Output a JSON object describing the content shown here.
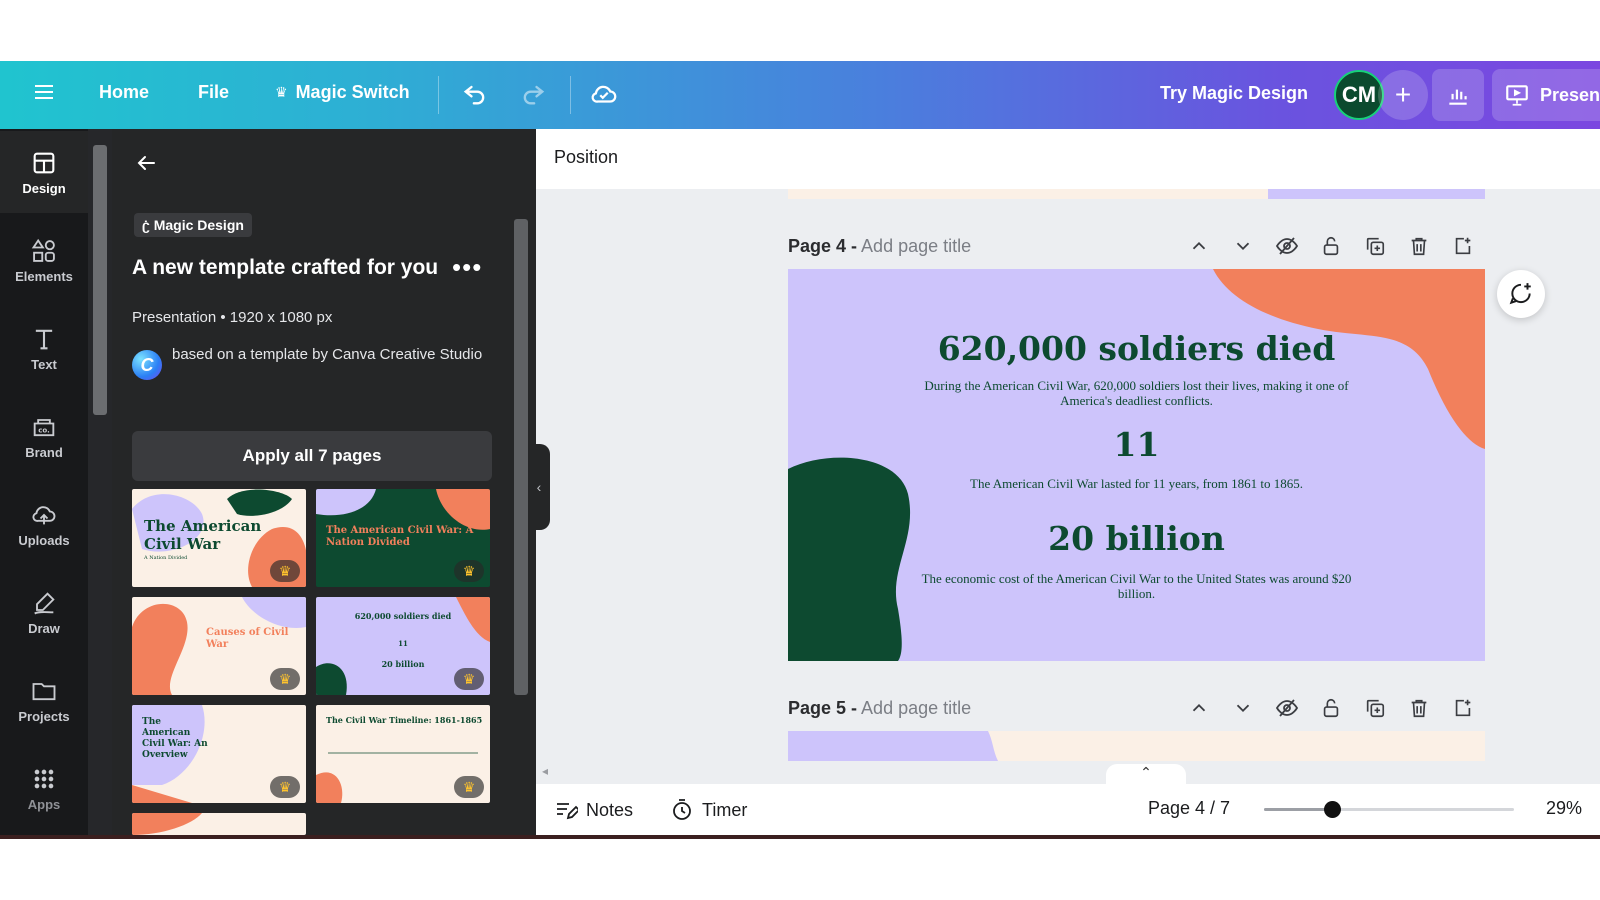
{
  "topbar": {
    "home": "Home",
    "file": "File",
    "magic_switch": "Magic Switch",
    "try_magic_design": "Try Magic Design",
    "avatar_initials": "CM",
    "present": "Present"
  },
  "rail": [
    {
      "label": "Design",
      "icon": "design-icon"
    },
    {
      "label": "Elements",
      "icon": "elements-icon"
    },
    {
      "label": "Text",
      "icon": "text-icon"
    },
    {
      "label": "Brand",
      "icon": "brand-icon"
    },
    {
      "label": "Uploads",
      "icon": "uploads-icon"
    },
    {
      "label": "Draw",
      "icon": "draw-icon"
    },
    {
      "label": "Projects",
      "icon": "projects-icon"
    },
    {
      "label": "Apps",
      "icon": "apps-icon"
    }
  ],
  "panel": {
    "badge": "Magic Design",
    "title": "A new template crafted for you",
    "meta": "Presentation • 1920 x 1080 px",
    "credit": "based on a template by Canva Creative Studio",
    "credit_logo": "C",
    "apply": "Apply all 7 pages",
    "thumbs": [
      {
        "title": "The American Civil War",
        "sub": "A Nation Divided"
      },
      {
        "title": "The American Civil War: A Nation Divided"
      },
      {
        "title": "Causes of Civil War"
      },
      {
        "title": "620,000 soldiers died",
        "mid": "11",
        "low": "20 billion"
      },
      {
        "title": "The American Civil War: An Overview"
      },
      {
        "title": "The Civil War Timeline: 1861-1865"
      }
    ]
  },
  "canvas": {
    "position_label": "Position",
    "page4": {
      "num": "Page 4 -",
      "title_placeholder": "Add page title"
    },
    "page5": {
      "num": "Page 5 -",
      "title_placeholder": "Add page title"
    },
    "slide": {
      "stat1": "620,000 soldiers died",
      "desc1": "During the American Civil War, 620,000 soldiers lost their lives, making it one of America's deadliest conflicts.",
      "stat2": "11",
      "desc2": "The American Civil War lasted for 11 years, from 1861 to 1865.",
      "stat3": "20 billion",
      "desc3": "The economic cost of the American Civil War to the United States was around $20 billion."
    }
  },
  "bottombar": {
    "notes": "Notes",
    "timer": "Timer",
    "page_indicator": "Page 4 / 7",
    "zoom": "29%",
    "zoom_slider_level": 0.27
  },
  "colors": {
    "slide_bg": "#cdc4fb",
    "dark_green": "#0d4a30",
    "coral": "#f2805c",
    "cream": "#fbf0e6"
  }
}
